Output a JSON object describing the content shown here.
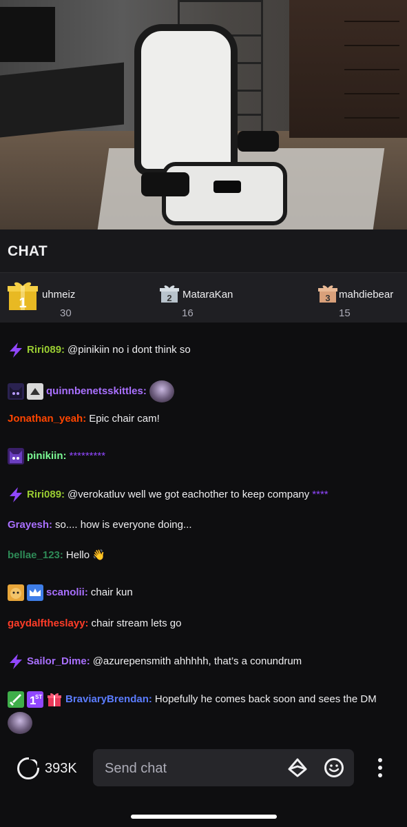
{
  "chat_title": "CHAT",
  "leaderboard": [
    {
      "rank": "1",
      "name": "uhmeiz",
      "count": "30"
    },
    {
      "rank": "2",
      "name": "MataraKan",
      "count": "16"
    },
    {
      "rank": "3",
      "name": "mahdiebear",
      "count": "15"
    }
  ],
  "messages": [
    {
      "user": "Riri089:",
      "text": "@pinikiin no i dont think so",
      "color": "#9acd32"
    },
    {
      "user": "quinnbenetsskittles:",
      "text": "",
      "color": "#a970ff"
    },
    {
      "user": "Jonathan_yeah:",
      "text": "Epic chair cam!",
      "color": "#ff4500"
    },
    {
      "user": "pinikiin:",
      "text": "*********",
      "color": "#7cfc96"
    },
    {
      "user": "Riri089:",
      "text": "@verokatluv well we got eachother to keep company",
      "stars": "****",
      "color": "#9acd32"
    },
    {
      "user": "Grayesh:",
      "text": "so.... how is everyone doing...",
      "color": "#a970ff"
    },
    {
      "user": "bellae_123:",
      "text": "Hello 👋",
      "color": "#2e8b57"
    },
    {
      "user": "scanolii:",
      "text": "chair kun",
      "color": "#a970ff"
    },
    {
      "user": "gaydalftheslayy:",
      "text": "chair stream lets go",
      "color": "#ff3c28"
    },
    {
      "user": "Sailor_Dime:",
      "text": "@azurepensmith ahhhhh, that’s a conundrum",
      "color": "#a970ff"
    },
    {
      "user": "BraviaryBrendan:",
      "text": "Hopefully he comes back soon and sees the DM",
      "color": "#5b7cff"
    }
  ],
  "bottom": {
    "points": "393K",
    "input_placeholder": "Send chat"
  },
  "colors": {
    "background": "#0e0e10",
    "accent": "#9147ff",
    "header_bg": "#18181b",
    "leaderboard_bg": "#1f1f23",
    "input_bg": "#26262a"
  },
  "icons": {
    "bits": "lightning-bolt-icon",
    "gift": "gift-icon",
    "points": "channel-points-icon",
    "bits_button": "bits-diamond-icon",
    "emote": "emote-smiley-icon",
    "more": "more-vertical-icon"
  }
}
